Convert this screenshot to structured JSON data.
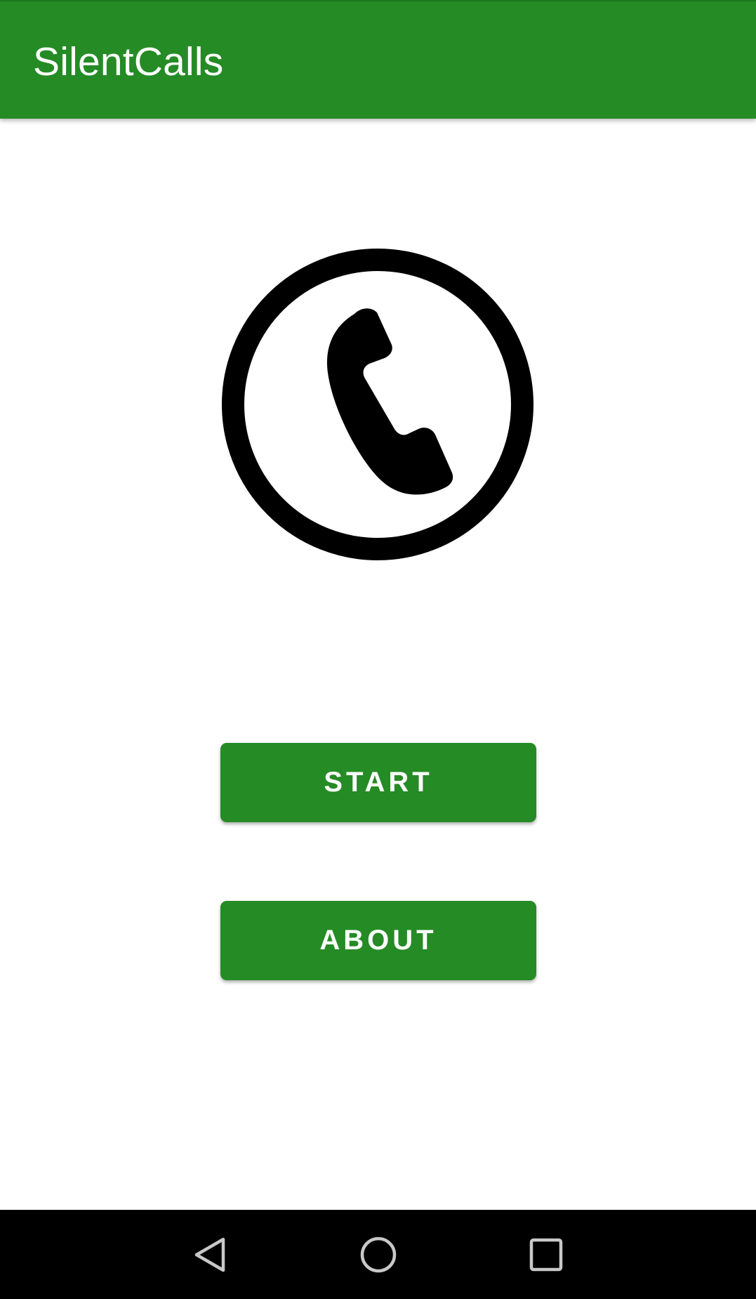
{
  "app": {
    "title": "SilentCalls",
    "brand_color": "#258b25"
  },
  "main": {
    "logo_icon": "phone-handset-in-circle-icon",
    "buttons": {
      "start_label": "START",
      "about_label": "ABOUT"
    }
  },
  "system_nav": {
    "back_icon": "back-triangle-icon",
    "home_icon": "home-circle-icon",
    "recents_icon": "recents-square-icon"
  }
}
